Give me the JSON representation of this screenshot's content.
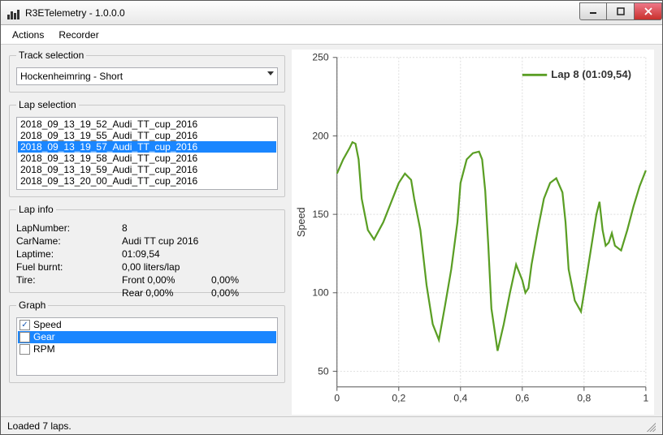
{
  "window": {
    "title": "R3ETelemetry - 1.0.0.0"
  },
  "menubar": {
    "actions": "Actions",
    "recorder": "Recorder"
  },
  "track_selection": {
    "legend": "Track selection",
    "value": "Hockenheimring - Short"
  },
  "lap_selection": {
    "legend": "Lap selection",
    "items": [
      "2018_09_13_19_52_Audi_TT_cup_2016",
      "2018_09_13_19_55_Audi_TT_cup_2016",
      "2018_09_13_19_57_Audi_TT_cup_2016",
      "2018_09_13_19_58_Audi_TT_cup_2016",
      "2018_09_13_19_59_Audi_TT_cup_2016",
      "2018_09_13_20_00_Audi_TT_cup_2016"
    ],
    "selected_index": 2
  },
  "lap_info": {
    "legend": "Lap info",
    "labels": {
      "lap_number": "LapNumber:",
      "car_name": "CarName:",
      "laptime": "Laptime:",
      "fuel_burnt": "Fuel burnt:",
      "tire": "Tire:"
    },
    "values": {
      "lap_number": "8",
      "car_name": "Audi TT cup 2016",
      "laptime": "01:09,54",
      "fuel_burnt": "0,00 liters/lap",
      "tire_front": "Front 0,00%",
      "tire_front_pct": "0,00%",
      "tire_rear": "Rear 0,00%",
      "tire_rear_pct": "0,00%"
    }
  },
  "graph": {
    "legend": "Graph",
    "items": [
      {
        "label": "Speed",
        "checked": true
      },
      {
        "label": "Gear",
        "checked": false
      },
      {
        "label": "RPM",
        "checked": false
      }
    ],
    "selected_index": 1
  },
  "status": {
    "text": "Loaded 7 laps."
  },
  "chart_data": {
    "type": "line",
    "title": "",
    "ylabel": "Speed",
    "xlabel": "",
    "xlim": [
      0,
      1
    ],
    "ylim": [
      40,
      250
    ],
    "xticks": [
      0,
      0.2,
      0.4,
      0.6,
      0.8,
      1
    ],
    "xtick_labels": [
      "0",
      "0,2",
      "0,4",
      "0,6",
      "0,8",
      "1"
    ],
    "yticks": [
      50,
      100,
      150,
      200,
      250
    ],
    "series": [
      {
        "name": "Lap 8 (01:09,54)",
        "color": "#5a9e24",
        "x": [
          0.0,
          0.02,
          0.04,
          0.05,
          0.06,
          0.07,
          0.08,
          0.1,
          0.12,
          0.15,
          0.18,
          0.2,
          0.22,
          0.24,
          0.25,
          0.27,
          0.29,
          0.31,
          0.33,
          0.35,
          0.37,
          0.39,
          0.4,
          0.42,
          0.44,
          0.46,
          0.47,
          0.48,
          0.49,
          0.5,
          0.52,
          0.54,
          0.56,
          0.58,
          0.6,
          0.61,
          0.62,
          0.63,
          0.65,
          0.67,
          0.69,
          0.71,
          0.73,
          0.74,
          0.75,
          0.77,
          0.79,
          0.8,
          0.82,
          0.84,
          0.85,
          0.86,
          0.87,
          0.88,
          0.89,
          0.9,
          0.92,
          0.94,
          0.96,
          0.98,
          1.0
        ],
        "values": [
          176,
          185,
          192,
          196,
          195,
          185,
          160,
          140,
          134,
          145,
          160,
          170,
          176,
          172,
          160,
          140,
          105,
          80,
          70,
          92,
          115,
          145,
          170,
          185,
          189,
          190,
          185,
          165,
          130,
          90,
          63,
          80,
          100,
          118,
          108,
          100,
          103,
          118,
          140,
          160,
          170,
          173,
          164,
          145,
          115,
          95,
          88,
          100,
          125,
          150,
          158,
          140,
          130,
          132,
          138,
          130,
          127,
          140,
          155,
          168,
          178
        ]
      }
    ]
  }
}
